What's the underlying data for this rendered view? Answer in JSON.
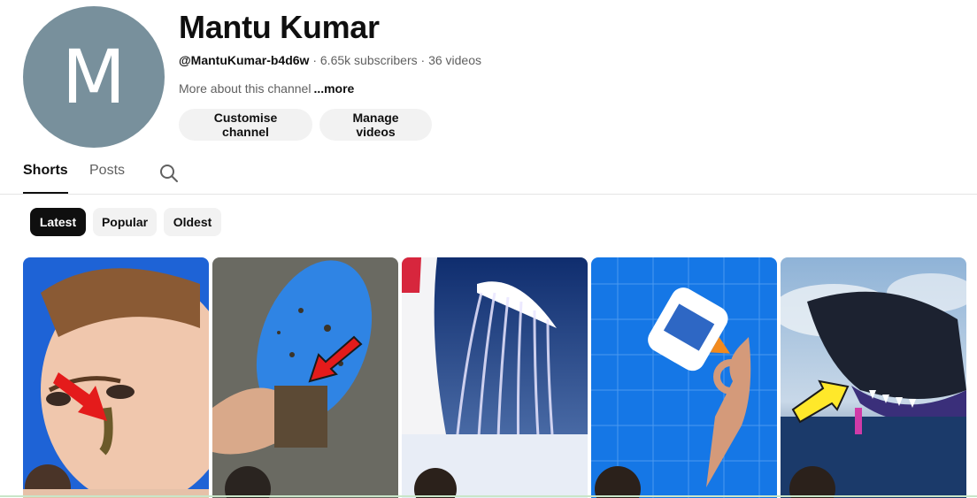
{
  "channel": {
    "avatar_letter": "M",
    "name": "Mantu Kumar",
    "handle": "@MantuKumar-b4d6w",
    "subscribers": "6.65k subscribers",
    "videos": "36 videos",
    "separator": " · ",
    "about": "More about this channel",
    "more": "...more",
    "avatar_color": "#78909c"
  },
  "actions": {
    "customise_label": "Customise channel",
    "manage_label": "Manage videos"
  },
  "tabs": [
    {
      "label": "Shorts",
      "selected": true
    },
    {
      "label": "Posts",
      "selected": false
    }
  ],
  "tab_search_icon": "search-icon",
  "filters": [
    {
      "label": "Latest",
      "selected": true
    },
    {
      "label": "Popular",
      "selected": false
    },
    {
      "label": "Oldest",
      "selected": false
    }
  ],
  "shorts": [
    {
      "subject": "face-with-red-arrow",
      "accent": "#1e63d6"
    },
    {
      "subject": "blue-paddle-in-dirt",
      "accent": "#2a7ae0"
    },
    {
      "subject": "jellyfish-glass",
      "accent": "#1b3c80"
    },
    {
      "subject": "glue-bottle-hand",
      "accent": "#1577e6"
    },
    {
      "subject": "shark-with-yellow-arrow",
      "accent": "#2e5d9a"
    }
  ]
}
